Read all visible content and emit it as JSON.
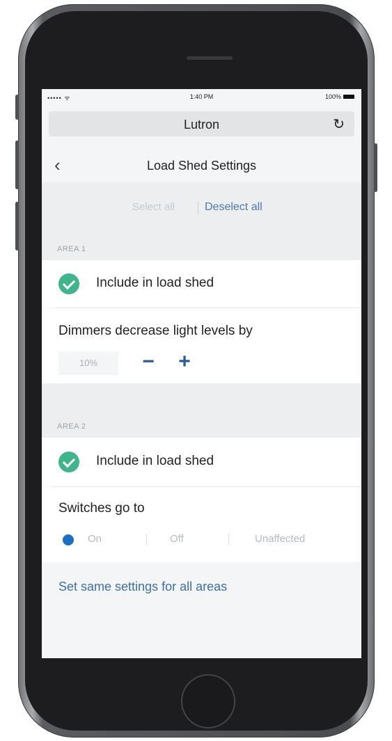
{
  "status_bar": {
    "signal": "••••• ᯤ",
    "time": "1:40 PM",
    "battery": "100%"
  },
  "app_bar": {
    "title": "Lutron",
    "refresh_icon": "refresh-icon"
  },
  "nav": {
    "back_icon": "chevron-left-icon",
    "title": "Load Shed Settings"
  },
  "selection": {
    "select_all": "Select all",
    "deselect_all": "Deselect all"
  },
  "areas": [
    {
      "header": "AREA 1",
      "include_label": "Include in load shed",
      "include_checked": true,
      "setting_label": "Dimmers decrease light levels by",
      "percent_value": "10%",
      "minus_label": "−",
      "plus_label": "+"
    },
    {
      "header": "AREA 2",
      "include_label": "Include in load shed",
      "include_checked": true,
      "setting_label": "Switches go to",
      "options": [
        "On",
        "Off",
        "Unaffected"
      ],
      "selected_option": "On"
    }
  ],
  "footer_link": "Set same settings for all areas",
  "colors": {
    "accent_blue": "#4b79b4",
    "check_green": "#3fb58b",
    "radio_blue": "#1d6fc2"
  }
}
